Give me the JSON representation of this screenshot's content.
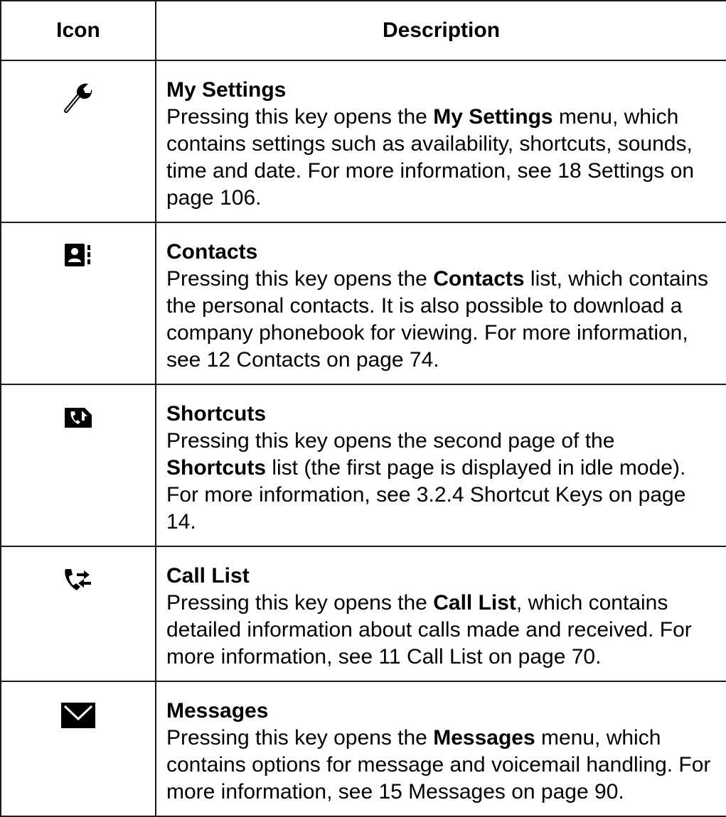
{
  "table": {
    "header_icon": "Icon",
    "header_description": "Description",
    "rows": [
      {
        "icon": "wrench-icon",
        "title": "My Settings",
        "text_before": "Pressing this key opens the ",
        "bold": "My Settings",
        "text_after": " menu, which contains settings such as availability, shortcuts, sounds, time and date. For more information, see 18 Settings on page 106."
      },
      {
        "icon": "contacts-book-icon",
        "title": "Contacts",
        "text_before": "Pressing this key opens the ",
        "bold": "Contacts",
        "text_after": " list, which contains the personal contacts. It is also possible to download a company phonebook for viewing. For more information, see 12 Contacts on page 74."
      },
      {
        "icon": "shortcut-phone-icon",
        "title": "Shortcuts",
        "text_before": "Pressing this key opens the second page of the ",
        "bold": "Shortcuts",
        "text_after": " list (the first page is displayed in idle mode). For more information, see 3.2.4 Shortcut Keys on page 14."
      },
      {
        "icon": "call-list-icon",
        "title": "Call List",
        "text_before": "Pressing this key opens the ",
        "bold": "Call List",
        "text_after": ", which contains detailed information about calls made and received. For more information, see 11 Call List on page 70."
      },
      {
        "icon": "envelope-icon",
        "title": "Messages",
        "text_before": "Pressing this key opens the ",
        "bold": "Messages",
        "text_after": " menu, which contains options for message and voicemail handling. For more information, see 15 Messages on page 90."
      }
    ]
  }
}
